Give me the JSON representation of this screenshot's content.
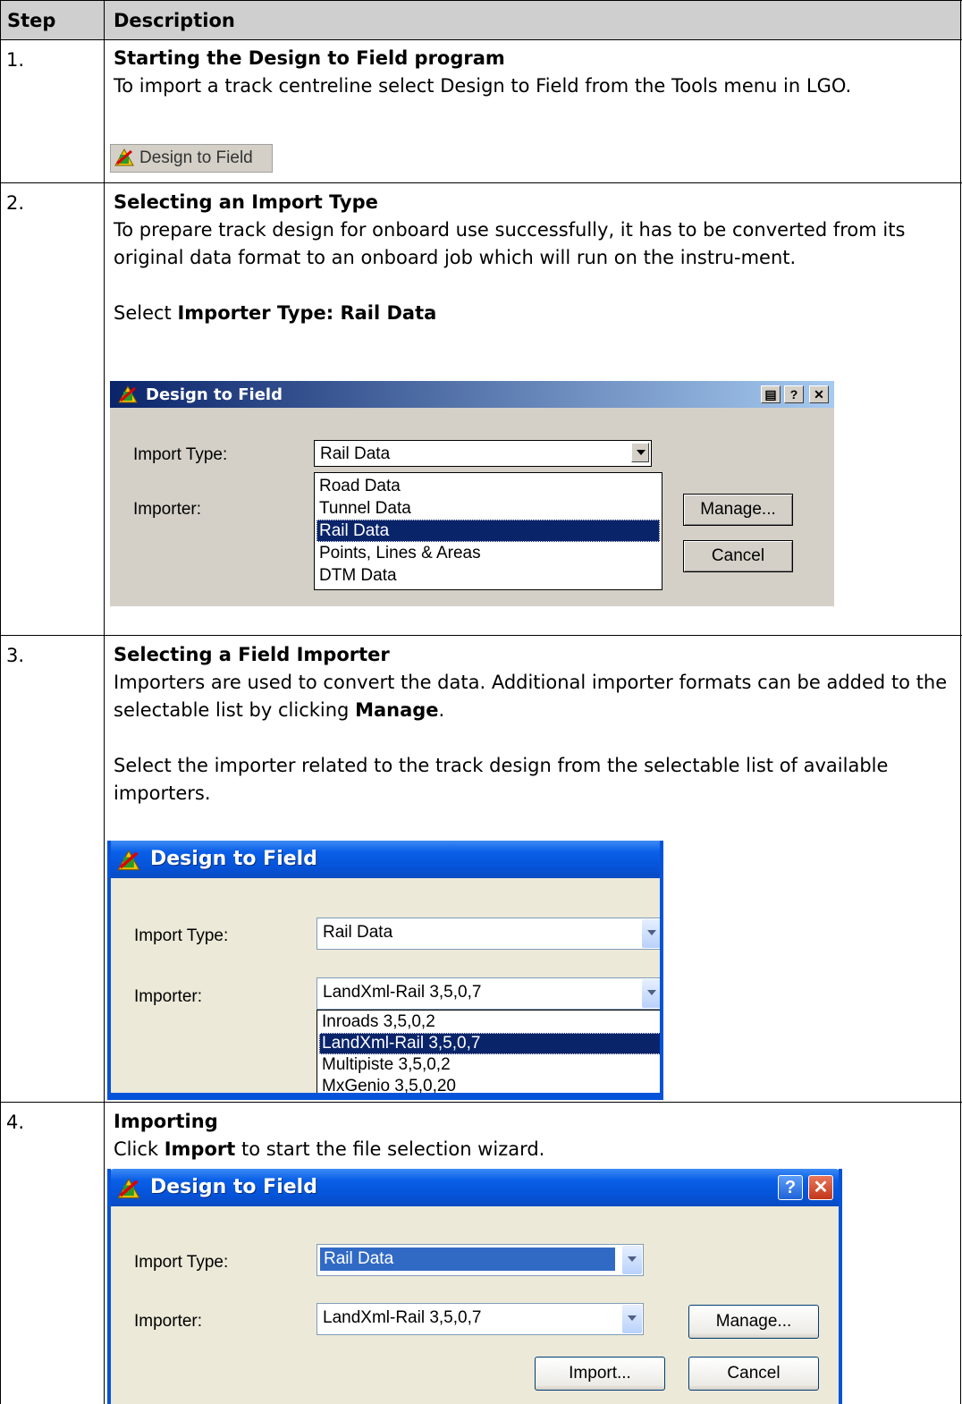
{
  "table": {
    "header": {
      "step": "Step",
      "description": "Description"
    }
  },
  "steps": [
    {
      "num": "1.",
      "title": "Starting the Design to Field program",
      "text": "To import a track centreline select Design to Field from the Tools menu in LGO.",
      "menu_item": "Design to Field"
    },
    {
      "num": "2.",
      "title": "Selecting an Import Type",
      "text": "To prepare track design for onboard use successfully, it has to be converted from its original data format to an onboard job which will run on the instru-ment.",
      "select_prefix": "Select",
      "select_bold": "Importer Type: Rail Data",
      "dialog": {
        "title": "Design to Field",
        "import_type_label": "Import Type:",
        "import_type_value": "Rail Data",
        "importer_label": "Importer:",
        "options": [
          "Road Data",
          "Tunnel Data",
          "Rail Data",
          "Points, Lines & Areas",
          "DTM Data"
        ],
        "selected_option": "Rail Data",
        "manage_button": "Manage...",
        "cancel_button": "Cancel"
      }
    },
    {
      "num": "3.",
      "title": "Selecting a Field Importer",
      "text_a": "Importers are used to convert the data. Additional importer formats can be added to the selectable list by clicking",
      "text_a_bold": "Manage",
      "text_b": "Select the importer related to the track design from the selectable list of available importers.",
      "dialog": {
        "title": "Design to Field",
        "import_type_label": "Import Type:",
        "import_type_value": "Rail Data",
        "importer_label": "Importer:",
        "importer_value": "LandXml-Rail 3,5,0,7",
        "options": [
          "Inroads 3,5,0,2",
          "LandXml-Rail 3,5,0,7",
          "Multipiste 3,5,0,2",
          "MxGenio 3,5,0,20"
        ],
        "selected_option": "LandXml-Rail 3,5,0,7"
      }
    },
    {
      "num": "4.",
      "title": "Importing",
      "text_prefix": "Click",
      "text_bold": "Import",
      "text_suffix": "to start the file selection wizard.",
      "dialog": {
        "title": "Design to Field",
        "import_type_label": "Import Type:",
        "import_type_value": "Rail Data",
        "importer_label": "Importer:",
        "importer_value": "LandXml-Rail 3,5,0,7",
        "manage_button": "Manage...",
        "import_button": "Import...",
        "cancel_button": "Cancel"
      }
    }
  ],
  "colors": {
    "header_bg": "#cfcfcf",
    "classic_title": "#0a246a",
    "xp_title": "#0553d8",
    "xp_body": "#ece9d8"
  }
}
